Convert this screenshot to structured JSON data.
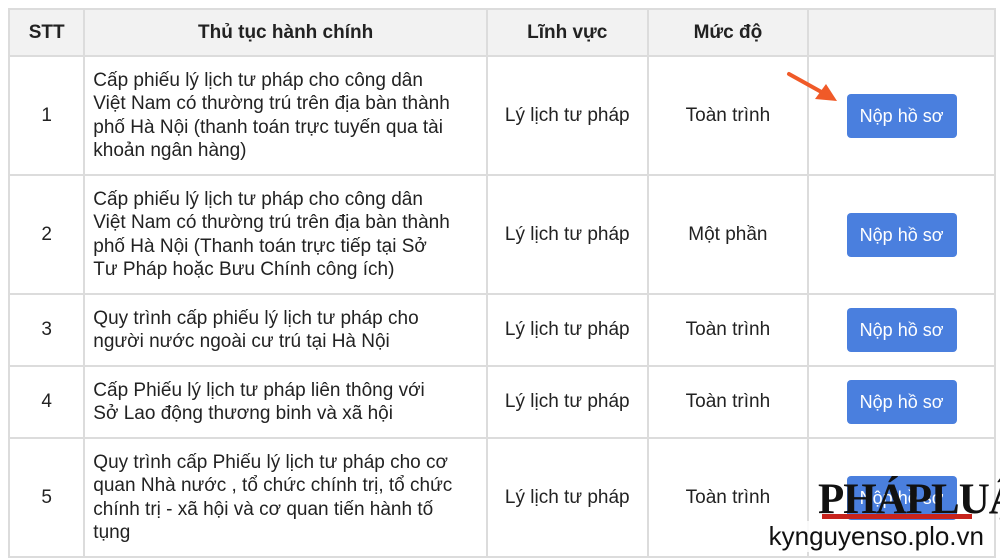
{
  "table": {
    "headers": {
      "stt": "STT",
      "procedure": "Thủ tục hành chính",
      "field": "Lĩnh vực",
      "level": "Mức độ",
      "action": ""
    },
    "rows": [
      {
        "stt": "1",
        "name_lines": [
          "Cấp phiếu lý lịch tư pháp cho công dân",
          "Việt Nam có thường trú trên địa bàn thành",
          "phố Hà Nội (thanh toán trực tuyến qua tài",
          "khoản ngân hàng)"
        ],
        "field": "Lý lịch tư pháp",
        "level": "Toàn trình",
        "button": "Nộp hồ sơ"
      },
      {
        "stt": "2",
        "name_lines": [
          "Cấp phiếu lý lịch tư pháp cho công dân",
          "Việt Nam có thường trú trên địa bàn thành",
          "phố Hà Nội (Thanh toán trực tiếp tại Sở",
          "Tư Pháp hoặc Bưu Chính công ích)"
        ],
        "field": "Lý lịch tư pháp",
        "level": "Một phần",
        "button": "Nộp hồ sơ"
      },
      {
        "stt": "3",
        "name_lines": [
          "Quy trình cấp phiếu lý lịch tư pháp cho",
          "người nước ngoài cư trú tại Hà Nội"
        ],
        "field": "Lý lịch tư pháp",
        "level": "Toàn trình",
        "button": "Nộp hồ sơ"
      },
      {
        "stt": "4",
        "name_lines": [
          "Cấp Phiếu lý lịch tư pháp liên thông với",
          "Sở Lao động thương binh và xã hội"
        ],
        "field": "Lý lịch tư pháp",
        "level": "Toàn trình",
        "button": "Nộp hồ sơ"
      },
      {
        "stt": "5",
        "name_lines": [
          "Quy trình cấp Phiếu lý lịch tư pháp cho cơ",
          "quan Nhà nước , tổ chức chính trị, tổ chức",
          "chính trị - xã hội và cơ quan tiến hành tố",
          "tụng"
        ],
        "field": "Lý lịch tư pháp",
        "level": "Toàn trình",
        "button": "Nộp hồ sơ"
      }
    ]
  },
  "annotation": {
    "arrow_icon": "arrow-pointing-right-icon",
    "color": "#f05a28"
  },
  "branding": {
    "logo": "PHÁPLUẬT",
    "website": "kynguyenso.plo.vn"
  },
  "colors": {
    "button_bg": "#4a7fde",
    "header_bg": "#f2f2f2",
    "grid": "#dcdcdc",
    "arrow": "#f05a28"
  }
}
